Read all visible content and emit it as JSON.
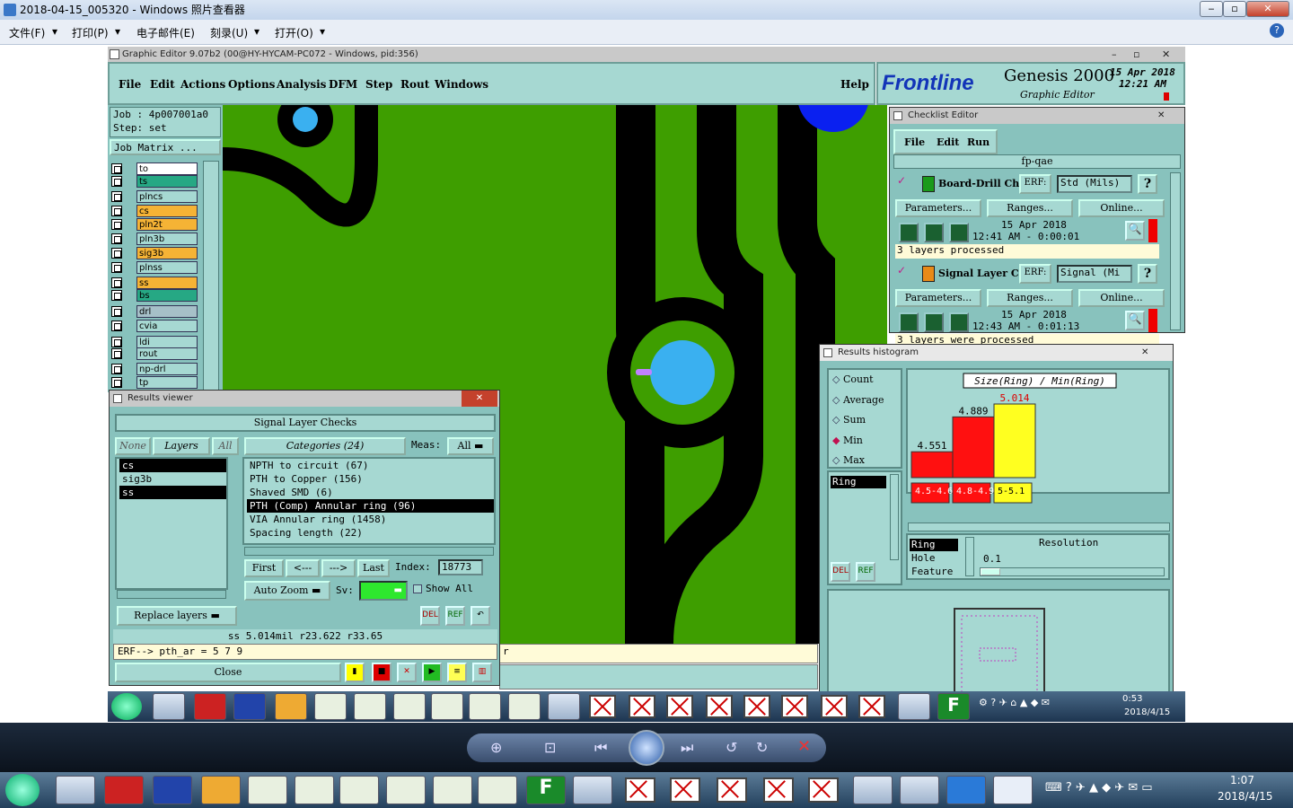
{
  "photo_viewer": {
    "title": "2018-04-15_005320 - Windows 照片查看器",
    "menu": [
      "文件(F)",
      "打印(P)",
      "电子邮件(E)",
      "刻录(U)",
      "打开(O)"
    ],
    "help_icon": "help-icon"
  },
  "genesis": {
    "window_title": "Graphic Editor 9.07b2 (00@HY-HYCAM-PC072 - Windows, pid:356)",
    "menu": [
      "File",
      "Edit",
      "Actions",
      "Options",
      "Analysis",
      "DFM",
      "Step",
      "Rout",
      "Windows"
    ],
    "help": "Help",
    "brand": "Frontline",
    "product": "Genesis 2000",
    "subtitle": "Graphic Editor",
    "date": "15 Apr 2018",
    "time": "12:21 AM",
    "job": "Job : 4p007001a0",
    "step": "Step: set",
    "job_matrix": "Job Matrix ...",
    "layers": [
      {
        "name": "to",
        "color": "#ffffff"
      },
      {
        "name": "ts",
        "color": "#26a884"
      },
      {
        "name": "plncs",
        "color": "#a6d8d2"
      },
      {
        "name": "cs",
        "color": "#f5b335"
      },
      {
        "name": "pln2t",
        "color": "#f5b335"
      },
      {
        "name": "pln3b",
        "color": "#a6d8d2"
      },
      {
        "name": "sig3b",
        "color": "#f5b335"
      },
      {
        "name": "plnss",
        "color": "#a6d8d2"
      },
      {
        "name": "ss",
        "color": "#f5b335"
      },
      {
        "name": "bs",
        "color": "#26a884"
      },
      {
        "name": "drl",
        "color": "#a6c0c8"
      },
      {
        "name": "cvia",
        "color": "#a6d8d2"
      },
      {
        "name": "ldi",
        "color": "#a6d8d2"
      },
      {
        "name": "rout",
        "color": "#a6d8d2"
      },
      {
        "name": "np-drl",
        "color": "#a6d8d2"
      },
      {
        "name": "tp",
        "color": "#a6d8d2"
      }
    ]
  },
  "checklist": {
    "title": "Checklist Editor",
    "menu": [
      "File",
      "Edit",
      "Run"
    ],
    "name": "fp-qae",
    "erf_label": "ERF:",
    "items": [
      {
        "name": "Board-Drill Che",
        "erf": "Std (Mils)",
        "date": "15 Apr 2018",
        "time": "12:41 AM - 0:00:01",
        "status": "3 layers processed"
      },
      {
        "name": "Signal Layer Ch",
        "erf": "Signal (Mi",
        "date": "15 Apr 2018",
        "time": "12:43 AM - 0:01:13",
        "status": "3 layers were processed"
      }
    ],
    "buttons": [
      "Parameters...",
      "Ranges...",
      "Online..."
    ]
  },
  "histogram": {
    "title": "Results histogram",
    "options": [
      "Count",
      "Average",
      "Sum",
      "Min",
      "Max"
    ],
    "selected": "Min",
    "list_item": "Ring",
    "chart_title": "Size(Ring) / Min(Ring)",
    "value_labels": [
      "4.551",
      "4.889",
      "5.014"
    ],
    "bin_labels": [
      "4.5-4.6",
      "4.8-4.9",
      "5-5.1"
    ],
    "feature_list": [
      "Ring",
      "Hole",
      "Feature"
    ],
    "resolution_label": "Resolution",
    "resolution_value": "0.1",
    "btn_del": "DEL",
    "btn_ref": "REF"
  },
  "chart_data": {
    "type": "bar",
    "title": "Size(Ring) / Min(Ring)",
    "categories": [
      "4.5-4.6",
      "4.8-4.9",
      "5-5.1"
    ],
    "values": [
      4.551,
      4.889,
      5.014
    ],
    "colors": [
      "#ff1010",
      "#ff1010",
      "#ffff20"
    ]
  },
  "results_viewer": {
    "title": "Results viewer",
    "header": "Signal Layer Checks",
    "none": "None",
    "layers": "Layers",
    "all": "All",
    "categories_label": "Categories (24)",
    "meas_label": "Meas:",
    "meas_value": "All",
    "layer_list": [
      "cs",
      "sig3b",
      "ss"
    ],
    "categories": [
      "NPTH to circuit (67)",
      "PTH to Copper (156)",
      "Shaved SMD (6)",
      "PTH (Comp) Annular ring (96)",
      "VIA Annular ring (1458)",
      "Spacing length (22)"
    ],
    "selected_category": "PTH (Comp) Annular ring (96)",
    "nav": [
      "First",
      "<---",
      "--->",
      "Last"
    ],
    "index_label": "Index:",
    "index_value": "18773",
    "auto_zoom": "Auto Zoom",
    "sv_label": "Sv:",
    "show_all": "Show All",
    "replace_layers": "Replace layers",
    "status": "ss 5.014mil  r23.622  r33.65",
    "erf_line": "ERF--> pth_ar = 5 7 9",
    "close": "Close"
  },
  "inner_taskbar": {
    "time": "0:53",
    "date": "2018/4/15"
  },
  "outer_taskbar": {
    "time": "1:07",
    "date": "2018/4/15"
  }
}
